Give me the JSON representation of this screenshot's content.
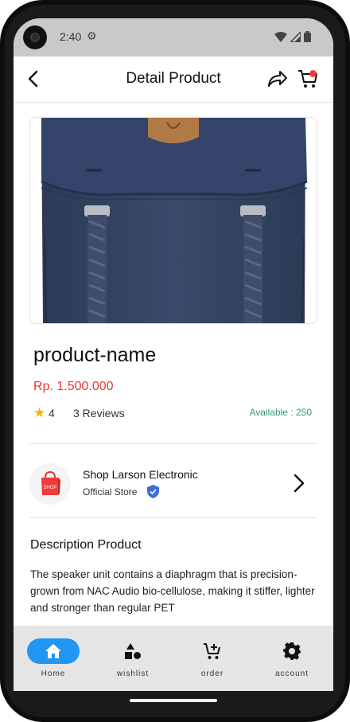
{
  "status_bar": {
    "time": "2:40"
  },
  "header": {
    "title": "Detail Product"
  },
  "product": {
    "name": "product-name",
    "price": "Rp. 1.500.000",
    "rating": "4",
    "reviews": "3 Reviews",
    "availability": "Available : 250"
  },
  "shop": {
    "logo_text": "SHOP",
    "name": "Shop Larson Electronic",
    "badge": "Official Store"
  },
  "description": {
    "title": "Description Product",
    "text": "The speaker unit contains a diaphragm that is precision-grown from NAC Audio bio-cellulose, making it stiffer, lighter and stronger than regular PET"
  },
  "bottom_nav": {
    "items": [
      {
        "label": "Home",
        "icon": "home-icon",
        "active": true
      },
      {
        "label": "wishlist",
        "icon": "shapes-icon",
        "active": false
      },
      {
        "label": "order",
        "icon": "cart-plus-icon",
        "active": false
      },
      {
        "label": "account",
        "icon": "gear-icon",
        "active": false
      }
    ]
  },
  "colors": {
    "accent": "#2196f3",
    "price": "#e53935",
    "availability": "#2e9b6e",
    "cart_badge": "#ee3b3b",
    "verified": "#3b6fd8"
  }
}
